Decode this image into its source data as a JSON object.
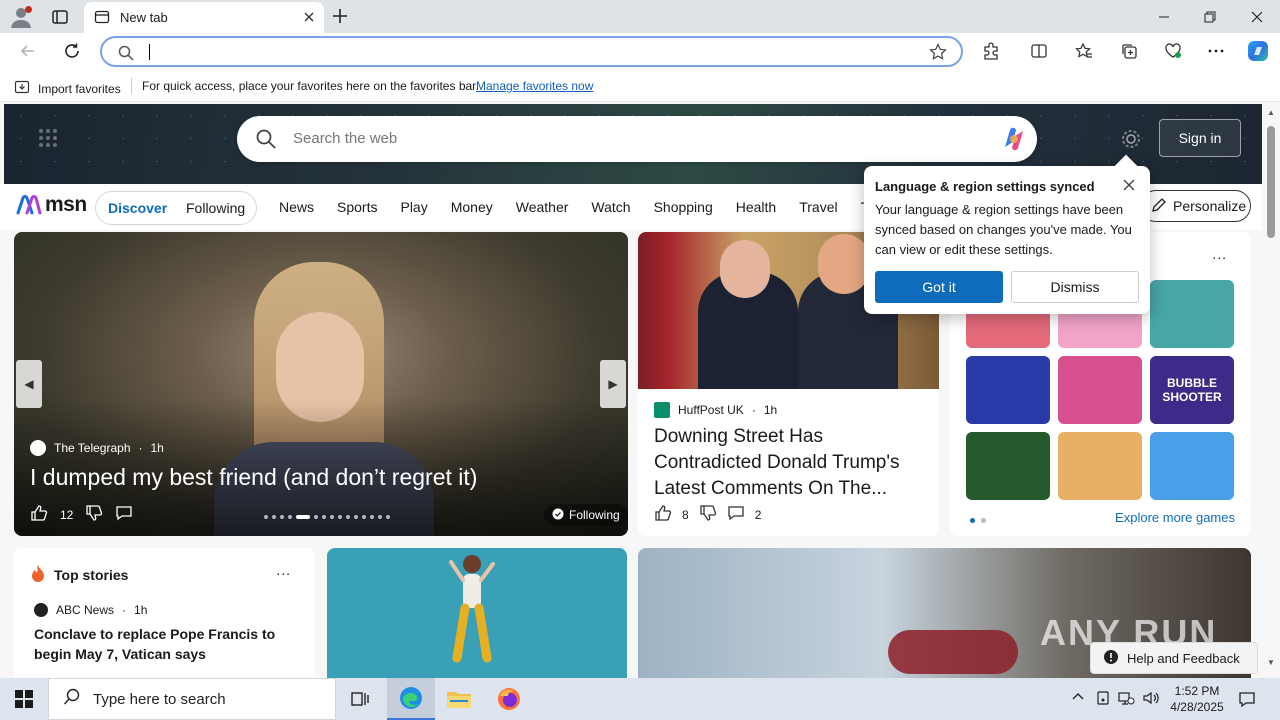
{
  "browser": {
    "tab_title": "New tab",
    "address_value": "",
    "favorites_bar": {
      "import_label": "Import favorites",
      "message": "For quick access, place your favorites here on the favorites bar.",
      "manage_link": "Manage favorites now"
    }
  },
  "hero": {
    "search_placeholder": "Search the web",
    "signin_label": "Sign in"
  },
  "nav": {
    "logo_text": "msn",
    "discover": "Discover",
    "following": "Following",
    "links": [
      "News",
      "Sports",
      "Play",
      "Money",
      "Weather",
      "Watch",
      "Shopping",
      "Health",
      "Travel",
      "T"
    ],
    "personalize": "Personalize"
  },
  "feature": {
    "source": "The Telegraph",
    "age": "1h",
    "headline": "I dumped my best friend (and don’t regret it)",
    "likes": "12",
    "following_label": "Following"
  },
  "news2": {
    "source": "HuffPost UK",
    "age": "1h",
    "headline": "Downing Street Has Contradicted Donald Trump's Latest Comments On The...",
    "likes": "8",
    "comments": "2"
  },
  "games": {
    "menu": "...",
    "tiles": [
      "",
      "",
      "",
      "",
      "",
      "BUBBLE SHOOTER",
      "",
      "",
      ""
    ],
    "tile_colors": [
      "#e46a7a",
      "#f2a3c8",
      "#47a6a6",
      "#2a3aa8",
      "#d64f8f",
      "#3e2a88",
      "#245a2c",
      "#e8b064",
      "#4aa0e8"
    ],
    "explore": "Explore more games"
  },
  "top_stories": {
    "title": "Top stories",
    "menu": "...",
    "source": "ABC News",
    "age": "1h",
    "headline": "Conclave to replace Pope Francis to begin May 7, Vatican says"
  },
  "help": "Help and Feedback",
  "popup": {
    "title": "Language & region settings synced",
    "body": "Your language & region settings have been synced based on changes you've made. You can view or edit these settings.",
    "got_it": "Got it",
    "dismiss": "Dismiss"
  },
  "taskbar": {
    "search_placeholder": "Type here to search",
    "time": "1:52 PM",
    "date": "4/28/2025"
  },
  "colors": {
    "accent": "#0f6cbd",
    "omnibox_border": "#7aa3e5"
  }
}
